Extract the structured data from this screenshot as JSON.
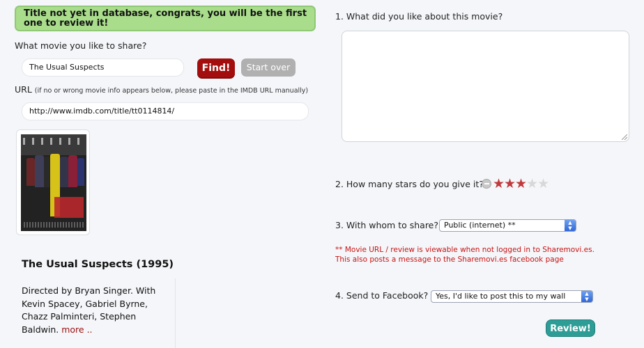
{
  "notice": {
    "text": "Title not yet in database, congrats, you will be the first one to review it!"
  },
  "form": {
    "movie_label": "What movie you like to share?",
    "movie_value": "The Usual Suspects",
    "find_label": "Find!",
    "start_over_label": "Start over",
    "url_label": "URL",
    "url_note": "(if no or wrong movie info appears below, please paste in the IMDB URL manually)",
    "url_value": "http://www.imdb.com/title/tt0114814/"
  },
  "movie": {
    "title": "The Usual Suspects (1995)",
    "description": "Directed by Bryan Singer. With Kevin Spacey, Gabriel Byrne, Chazz Palminteri, Stephen Baldwin. ",
    "more_label": "more .."
  },
  "review": {
    "q1": "1. What did you like about this movie?",
    "q2": "2. How many stars do you give it?",
    "rating": 3,
    "max_rating": 5,
    "q3": "3. With whom to share?",
    "share_value": "Public (internet) **",
    "note_line1": "** Movie URL / review is viewable when not logged in to Sharemovi.es.",
    "note_line2": "This also posts a message to the Sharemovi.es facebook page",
    "q4": "4. Send to Facebook?",
    "facebook_value": "Yes, I'd like to post this to my wall",
    "review_label": "Review!"
  },
  "colors": {
    "notice_bg": "#a9dd8c",
    "find_btn": "#a30d0d",
    "review_btn": "#2e9d96",
    "star_on": "#c0393c",
    "star_off": "#d8d8d8"
  },
  "icons": [
    "clear-rating-icon",
    "star-icon",
    "select-arrow-icon",
    "resize-grip-icon"
  ]
}
